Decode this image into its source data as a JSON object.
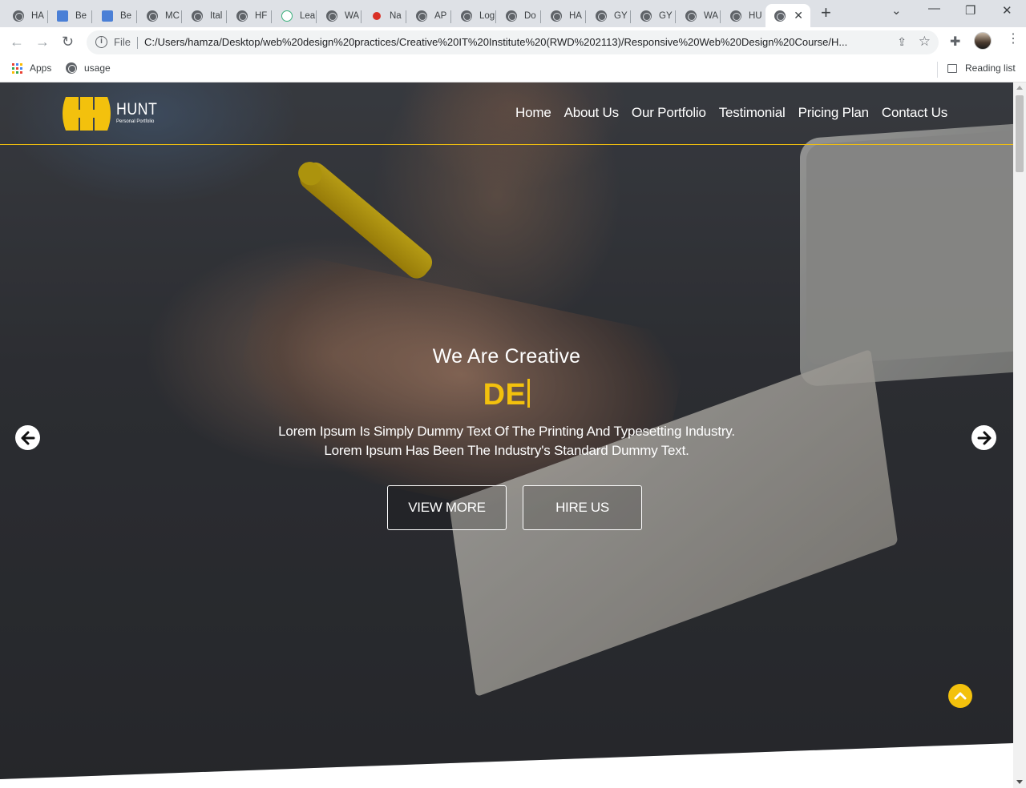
{
  "browser": {
    "tabs": [
      {
        "title": "HA",
        "icon": "globe-icon"
      },
      {
        "title": "Be",
        "icon": "behance-icon"
      },
      {
        "title": "Be",
        "icon": "behance-icon"
      },
      {
        "title": "MC",
        "icon": "globe-icon"
      },
      {
        "title": "Ital",
        "icon": "globe-icon"
      },
      {
        "title": "HF",
        "icon": "globe-icon"
      },
      {
        "title": "Lea",
        "icon": "leaf-icon"
      },
      {
        "title": "WA",
        "icon": "globe-icon"
      },
      {
        "title": "Na",
        "icon": "record-icon"
      },
      {
        "title": "AP",
        "icon": "globe-icon"
      },
      {
        "title": "Log",
        "icon": "globe-icon"
      },
      {
        "title": "Do",
        "icon": "globe-icon"
      },
      {
        "title": "HA",
        "icon": "globe-icon"
      },
      {
        "title": "GY",
        "icon": "globe-icon"
      },
      {
        "title": "GY",
        "icon": "globe-icon"
      },
      {
        "title": "WA",
        "icon": "globe-icon"
      },
      {
        "title": "HU",
        "icon": "globe-icon"
      }
    ],
    "address": {
      "scheme_label": "File",
      "url": "C:/Users/hamza/Desktop/web%20design%20practices/Creative%20IT%20Institute%20(RWD%202113)/Responsive%20Web%20Design%20Course/H..."
    },
    "bookmarks": [
      {
        "label": "Apps",
        "icon": "apps-grid-icon"
      },
      {
        "label": "usage",
        "icon": "globe-icon"
      }
    ],
    "reading_list": "Reading list"
  },
  "site": {
    "logo": {
      "name": "HUNT",
      "tagline": "Personal Portfolio"
    },
    "nav": [
      "Home",
      "About Us",
      "Our Portfolio",
      "Testimonial",
      "Pricing Plan",
      "Contact Us"
    ],
    "hero": {
      "title": "We Are Creative",
      "typed": "DE",
      "desc_line1": "Lorem Ipsum Is Simply Dummy Text Of The Printing And Typesetting Industry.",
      "desc_line2": "Lorem Ipsum Has Been The Industry's Standard Dummy Text.",
      "buttons": [
        "VIEW MORE",
        "HIRE US"
      ]
    }
  },
  "colors": {
    "accent": "#f3c10d",
    "text": "#ffffff",
    "tabstrip": "#dee1e6"
  }
}
